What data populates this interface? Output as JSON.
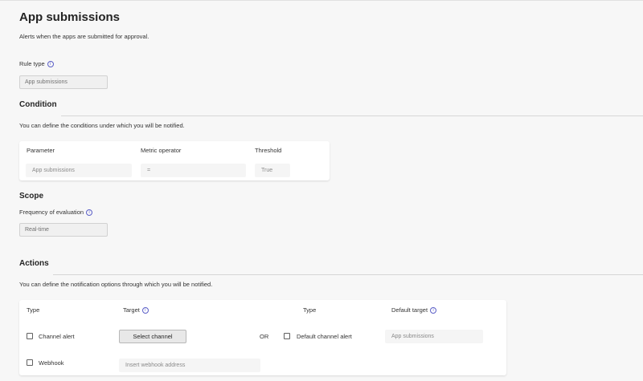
{
  "page": {
    "title": "App submissions",
    "description": "Alerts when the apps are submitted for approval."
  },
  "rule_type": {
    "label": "Rule type",
    "value": "App submissions"
  },
  "condition": {
    "heading": "Condition",
    "description": "You can define the conditions under which you will be notified.",
    "columns": [
      "Parameter",
      "Metric operator",
      "Threshold"
    ],
    "row": {
      "parameter": "App submissions",
      "operator": "=",
      "threshold": "True"
    }
  },
  "scope": {
    "heading": "Scope",
    "frequency_label": "Frequency of evaluation",
    "frequency_value": "Real-time"
  },
  "actions": {
    "heading": "Actions",
    "description": "You can define the notification options through which you will be notified.",
    "col_type": "Type",
    "col_target": "Target",
    "col_type2": "Type",
    "col_default_target": "Default target",
    "channel_alert_label": "Channel alert",
    "select_channel_button": "Select channel",
    "or_label": "OR",
    "default_channel_alert_label": "Default channel alert",
    "default_target_value": "App submissions",
    "webhook_label": "Webhook",
    "webhook_placeholder": "Insert webhook address"
  },
  "icons": {
    "info": "info-icon"
  },
  "colors": {
    "accent": "#5b5fc7",
    "background": "#f7f7f7",
    "card": "#ffffff"
  }
}
